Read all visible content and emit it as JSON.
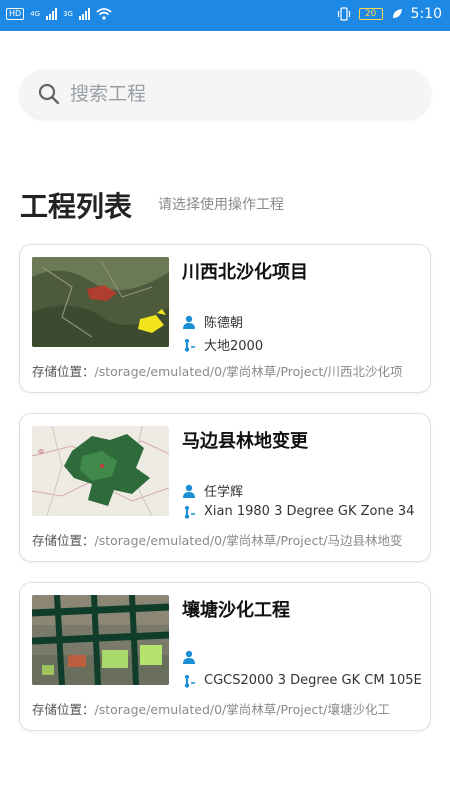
{
  "status_bar": {
    "hd": "HD",
    "net1": "4G",
    "net2": "3G",
    "battery": "20",
    "time": "5:10"
  },
  "search": {
    "placeholder": "搜索工程"
  },
  "section": {
    "title": "工程列表",
    "subtitle": "请选择使用操作工程"
  },
  "projects": [
    {
      "name": "川西北沙化项目",
      "user": "陈德朝",
      "crs": "大地2000",
      "path_label": "存储位置：",
      "path": "/storage/emulated/0/掌尚林草/Project/川西北沙化项"
    },
    {
      "name": "马边县林地变更",
      "user": "任学辉",
      "crs": "Xian 1980 3 Degree GK Zone 34",
      "path_label": "存储位置：",
      "path": "/storage/emulated/0/掌尚林草/Project/马边县林地变"
    },
    {
      "name": "壤塘沙化工程",
      "user": "",
      "crs": "CGCS2000 3 Degree GK CM 105E",
      "path_label": "存储位置：",
      "path": "/storage/emulated/0/掌尚林草/Project/壤塘沙化工"
    }
  ],
  "colors": {
    "status_bar": "#1e88e5",
    "accent_icon": "#1a8fd6"
  }
}
